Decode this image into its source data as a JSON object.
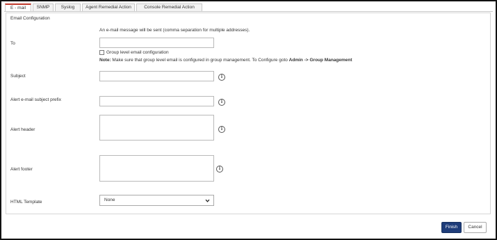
{
  "tabs": [
    {
      "label": "E - mail",
      "active": true
    },
    {
      "label": "SNMP",
      "active": false
    },
    {
      "label": "Syslog",
      "active": false
    },
    {
      "label": "Agent Remedial Action",
      "active": false
    },
    {
      "label": "Console Remedial Action",
      "active": false
    }
  ],
  "section_title": "Email Configuration",
  "email_hint": "An e-mail message will be sent (comma separation for multiple addresses).",
  "fields": {
    "to": {
      "label": "To",
      "value": ""
    },
    "group_level_checkbox": {
      "label": "Group level email configuration",
      "checked": false
    },
    "note": {
      "prefix": "Note:",
      "text": " Make sure that group level email is configured in group management. To Configure goto ",
      "admin": "Admin",
      "arrow": " -> ",
      "group_mgmt": "Group Management"
    },
    "subject": {
      "label": "Subject",
      "value": ""
    },
    "alert_prefix": {
      "label": "Alert e-mail subject prefix",
      "value": ""
    },
    "alert_header": {
      "label": "Alert header",
      "value": ""
    },
    "alert_footer": {
      "label": "Alert footer",
      "value": ""
    },
    "html_template": {
      "label": "HTML Template",
      "selected": "None"
    }
  },
  "info_icon": {
    "name": "info-icon",
    "glyph": "i"
  },
  "buttons": {
    "finish": "Finish",
    "cancel": "Cancel"
  },
  "colors": {
    "active_tab_accent": "#c0392b",
    "primary_button": "#1f3d7a"
  }
}
